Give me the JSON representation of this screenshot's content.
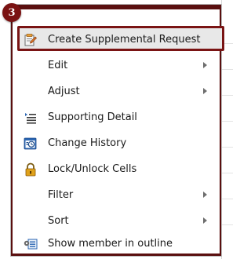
{
  "callout": {
    "step_number": "3"
  },
  "menu": {
    "items": [
      {
        "label": "Create Supplemental Request",
        "icon": "create-supplemental-request-icon",
        "has_submenu": false,
        "highlighted": true
      },
      {
        "label": "Edit",
        "icon": "",
        "has_submenu": true,
        "highlighted": false
      },
      {
        "label": "Adjust",
        "icon": "",
        "has_submenu": true,
        "highlighted": false
      },
      {
        "label": "Supporting Detail",
        "icon": "supporting-detail-icon",
        "has_submenu": false,
        "highlighted": false
      },
      {
        "label": "Change History",
        "icon": "change-history-icon",
        "has_submenu": false,
        "highlighted": false
      },
      {
        "label": "Lock/Unlock Cells",
        "icon": "lock-icon",
        "has_submenu": false,
        "highlighted": false
      },
      {
        "label": "Filter",
        "icon": "",
        "has_submenu": true,
        "highlighted": false
      },
      {
        "label": "Sort",
        "icon": "",
        "has_submenu": true,
        "highlighted": false
      },
      {
        "label": "Show member in outline",
        "icon": "show-member-in-outline-icon",
        "has_submenu": false,
        "highlighted": false
      }
    ]
  },
  "colors": {
    "callout_red": "#7a1414",
    "highlight_bg": "#e8e8e8",
    "icon_blue": "#2b66b3",
    "lock_gold": "#e0a21a"
  }
}
